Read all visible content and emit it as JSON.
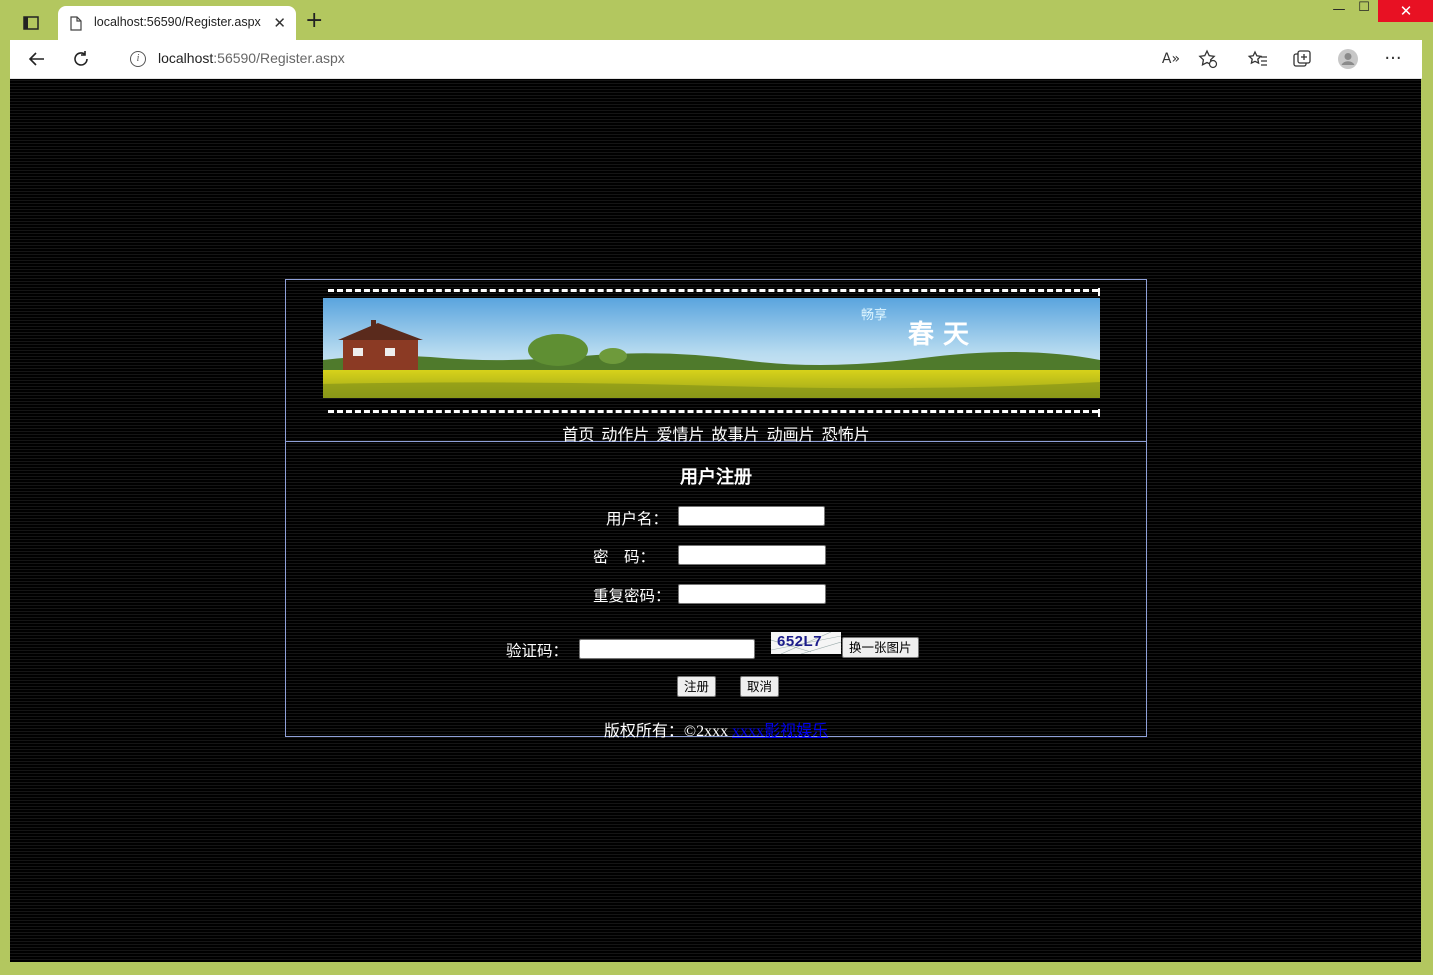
{
  "browser": {
    "tab_title": "localhost:56590/Register.aspx",
    "url_host": "localhost",
    "url_rest": ":56590/Register.aspx",
    "new_tab_glyph": "+",
    "icons": [
      "tab-actions-icon",
      "page-icon",
      "close-icon",
      "back-icon",
      "refresh-icon",
      "info-icon",
      "read-aloud-icon",
      "add-favorite-icon",
      "favorites-icon",
      "collections-icon",
      "profile-icon",
      "more-icon"
    ]
  },
  "header": {
    "banner_text_small": "畅享",
    "banner_text_big": "春 天",
    "nav": [
      "首页",
      "动作片",
      "爱情片",
      "故事片",
      "动画片",
      "恐怖片"
    ]
  },
  "form": {
    "title": "用户注册",
    "username_label": "用户名：",
    "password_label": "密　码：",
    "repeat_label": "重复密码：",
    "captcha_label": "验证码：",
    "captcha_code": "652L7",
    "refresh_captcha_button": "换一张图片",
    "register_button": "注册",
    "cancel_button": "取消"
  },
  "footer": {
    "copyright": "版权所有：©2xxx",
    "link_text": "xxxx影视娱乐"
  },
  "colors": {
    "frame": "#b3c75f",
    "page_bg": "#000000",
    "border": "#8fa0d8",
    "close_button": "#e81123"
  }
}
